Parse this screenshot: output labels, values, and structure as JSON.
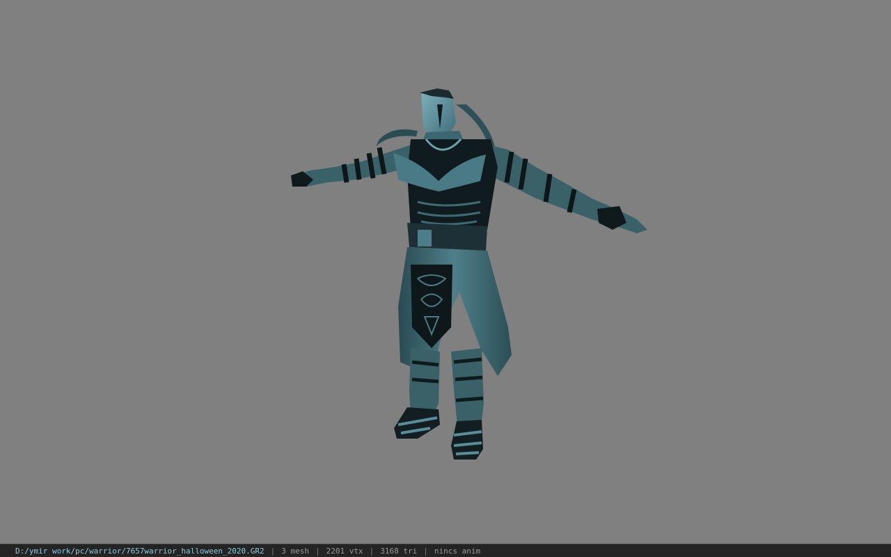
{
  "viewer": {
    "background_color": "#808080",
    "model_tint_color": "#5a8a96",
    "model_dark_color": "#0c1416"
  },
  "status_bar": {
    "file_path": "D:/ymir work/pc/warrior/7657warrior_halloween_2020.GR2",
    "separator": "|",
    "mesh_count": "3 mesh",
    "vertex_count": "2201 vtx",
    "triangle_count": "3168 tri",
    "animation": "nincs anim"
  }
}
